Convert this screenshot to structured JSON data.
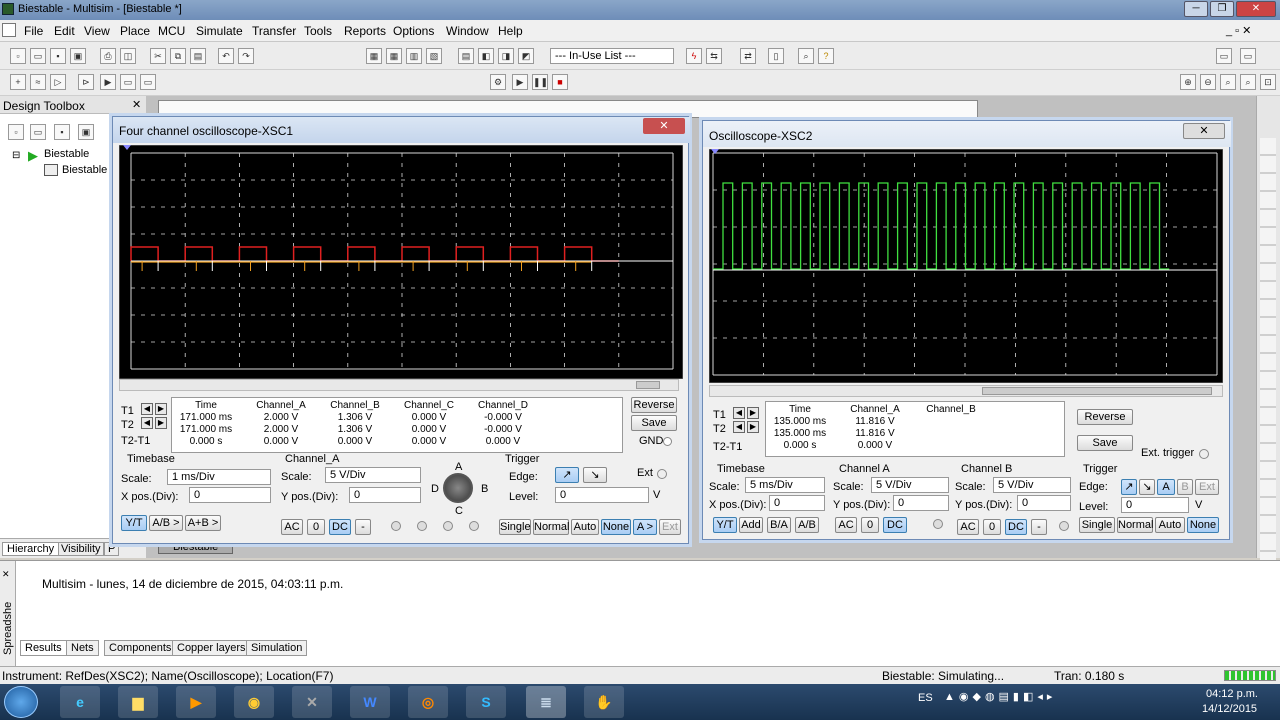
{
  "window": {
    "title": "Biestable - Multisim - [Biestable *]"
  },
  "menu": [
    "File",
    "Edit",
    "View",
    "Place",
    "MCU",
    "Simulate",
    "Transfer",
    "Tools",
    "Reports",
    "Options",
    "Window",
    "Help"
  ],
  "toolbar": {
    "in_use_list": "--- In-Use List ---"
  },
  "toolbox": {
    "title": "Design Toolbox",
    "tree_root": "Biestable",
    "tree_child": "Biestable",
    "tabs": [
      "Hierarchy",
      "Visibility",
      "P"
    ]
  },
  "canvas_tab": "Biestable",
  "scope1": {
    "title": "Four channel oscilloscope-XSC1",
    "close": "✕",
    "headers": [
      "Time",
      "Channel_A",
      "Channel_B",
      "Channel_C",
      "Channel_D"
    ],
    "rows": [
      {
        "label": "T1",
        "values": [
          "171.000 ms",
          "2.000 V",
          "1.306 V",
          "0.000 V",
          "-0.000 V"
        ]
      },
      {
        "label": "T2",
        "values": [
          "171.000 ms",
          "2.000 V",
          "1.306 V",
          "0.000 V",
          "-0.000 V"
        ]
      },
      {
        "label": "T2-T1",
        "values": [
          "0.000 s",
          "0.000 V",
          "0.000 V",
          "0.000 V",
          "0.000 V"
        ]
      }
    ],
    "reverse": "Reverse",
    "save": "Save",
    "gnd": "GND",
    "timebase": {
      "label": "Timebase",
      "scale_label": "Scale:",
      "scale": "1 ms/Div",
      "xpos_label": "X pos.(Div):",
      "xpos": "0"
    },
    "buttons_tb": [
      "Y/T",
      "A/B >",
      "A+B >"
    ],
    "channel": {
      "label": "Channel_A",
      "scale_label": "Scale:",
      "scale": "5  V/Div",
      "ypos_label": "Y pos.(Div):",
      "ypos": "0"
    },
    "ch_buttons": [
      "AC",
      "0",
      "DC",
      "-"
    ],
    "knob": {
      "a": "A",
      "b": "B",
      "c": "C",
      "d": "D"
    },
    "trigger": {
      "label": "Trigger",
      "edge_label": "Edge:",
      "level_label": "Level:",
      "level": "0",
      "unit": "V",
      "ext": "Ext"
    },
    "trig_buttons": [
      "Single",
      "Normal",
      "Auto",
      "None",
      "A >",
      "Ext"
    ]
  },
  "scope2": {
    "title": "Oscilloscope-XSC2",
    "close": "✕",
    "headers": [
      "Time",
      "Channel_A",
      "Channel_B"
    ],
    "rows": [
      {
        "label": "T1",
        "values": [
          "135.000 ms",
          "11.816 V",
          ""
        ]
      },
      {
        "label": "T2",
        "values": [
          "135.000 ms",
          "11.816 V",
          ""
        ]
      },
      {
        "label": "T2-T1",
        "values": [
          "0.000 s",
          "0.000 V",
          ""
        ]
      }
    ],
    "reverse": "Reverse",
    "save": "Save",
    "ext_trigger": "Ext. trigger",
    "timebase": {
      "label": "Timebase",
      "scale_label": "Scale:",
      "scale": "5 ms/Div",
      "xpos_label": "X pos.(Div):",
      "xpos": "0"
    },
    "tb_buttons": [
      "Y/T",
      "Add",
      "B/A",
      "A/B"
    ],
    "channel_a": {
      "label": "Channel A",
      "scale_label": "Scale:",
      "scale": "5  V/Div",
      "ypos_label": "Y pos.(Div):",
      "ypos": "0"
    },
    "channel_b": {
      "label": "Channel B",
      "scale_label": "Scale:",
      "scale": "5  V/Div",
      "ypos_label": "Y pos.(Div):",
      "ypos": "0"
    },
    "ch_buttons": [
      "AC",
      "0",
      "DC"
    ],
    "chb_buttons": [
      "AC",
      "0",
      "DC",
      "-"
    ],
    "trigger": {
      "label": "Trigger",
      "edge_label": "Edge:",
      "level_label": "Level:",
      "level": "0",
      "unit": "V",
      "a": "A",
      "b": "B",
      "ext": "Ext"
    },
    "trig_buttons": [
      "Single",
      "Normal",
      "Auto",
      "None"
    ]
  },
  "spreadsheet": {
    "side_label": "Spreadshe",
    "message": "Multisim  -  lunes, 14 de diciembre de 2015, 04:03:11 p.m.",
    "tabs": [
      "Results",
      "Nets",
      "Components",
      "Copper layers",
      "Simulation"
    ]
  },
  "statusbar": {
    "instrument": "Instrument: RefDes(XSC2); Name(Oscilloscope); Location(F7)",
    "sim": "Biestable: Simulating...",
    "tran": "Tran: 0.180 s"
  },
  "taskbar": {
    "lang": "ES",
    "time": "04:12 p.m.",
    "date": "14/12/2015"
  },
  "colors": {
    "trace_red": "#e02020",
    "trace_green": "#40e040",
    "trace_orange": "#f0a020",
    "trace_white": "#ffffff",
    "grid": "#d8d8d8"
  }
}
